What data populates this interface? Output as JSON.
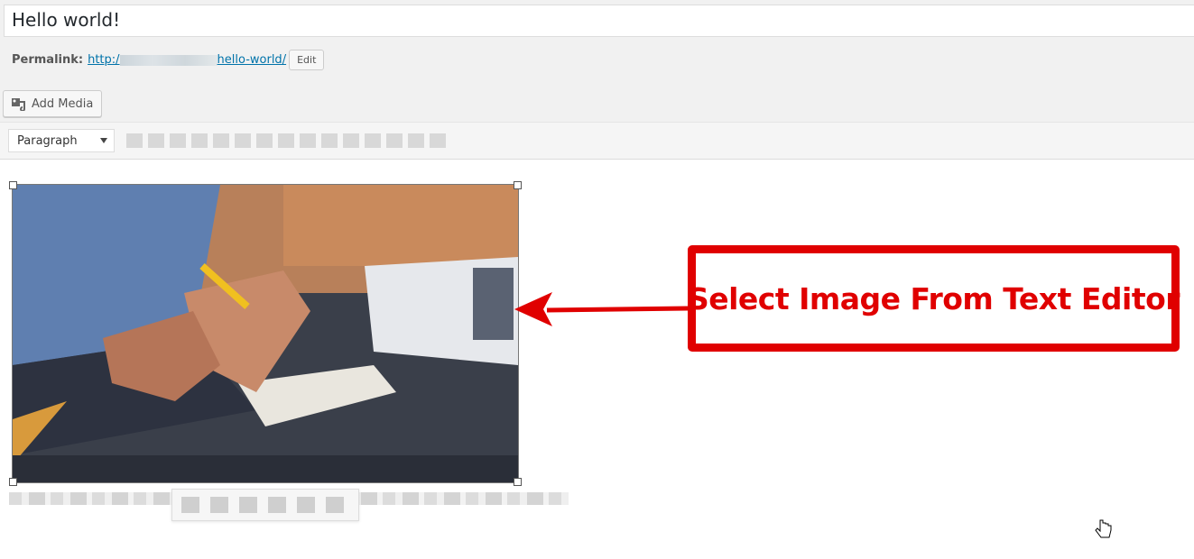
{
  "post": {
    "title": "Hello world!"
  },
  "permalink": {
    "label": "Permalink:",
    "url_start": "http:/",
    "url_end": "hello-world/",
    "edit_label": "Edit"
  },
  "media": {
    "add_media_label": "Add Media"
  },
  "toolbar": {
    "format_value": "Paragraph"
  },
  "image": {
    "description": "",
    "icon": "photo-image"
  },
  "annotation": {
    "text": "Select Image From Text Editor",
    "color": "#e00000"
  },
  "colors": {
    "link": "#0073aa",
    "accent_red": "#e00000"
  }
}
